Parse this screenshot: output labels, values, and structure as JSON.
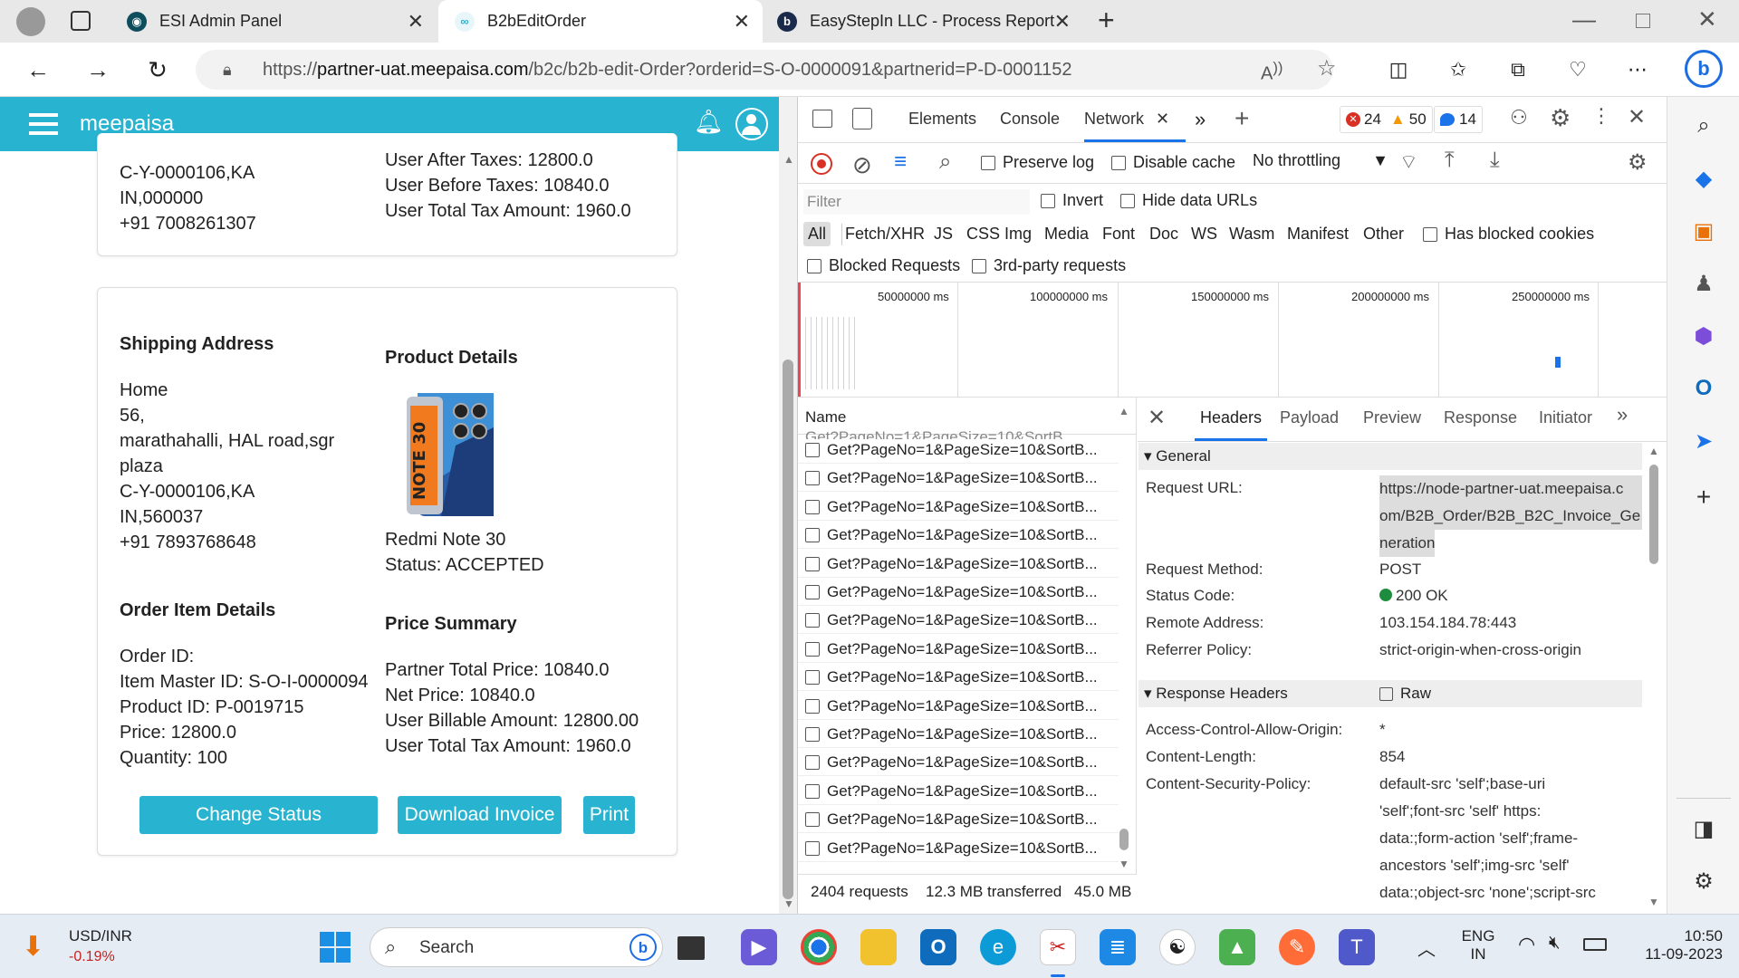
{
  "browser": {
    "tabs": [
      {
        "title": "ESI Admin Panel",
        "active": false
      },
      {
        "title": "B2bEditOrder",
        "active": true
      },
      {
        "title": "EasyStepIn LLC - Process Reportir",
        "active": false
      }
    ],
    "url_prefix": "https://",
    "url_host": "partner-uat.meepaisa.com",
    "url_path": "/b2c/b2b-edit-Order?orderid=S-O-0000091&partnerid=P-D-0001152"
  },
  "app": {
    "brand": "meepaisa",
    "top_card": {
      "left_lines": [
        "C-Y-0000106,KA",
        "IN,000000",
        "+91 7008261307"
      ],
      "right_lines": [
        "User After Taxes: 12800.0",
        "User Before Taxes: 10840.0",
        "User Total Tax Amount: 1960.0"
      ]
    },
    "shipping": {
      "heading": "Shipping Address",
      "lines": [
        "Home",
        "56,",
        "marathahalli, HAL road,sgr",
        "plaza",
        "C-Y-0000106,KA",
        "IN,560037",
        "+91 7893768648"
      ]
    },
    "product": {
      "heading": "Product Details",
      "name": "Redmi Note 30",
      "status": "Status: ACCEPTED"
    },
    "order_item": {
      "heading": "Order Item Details",
      "lines": [
        "Order ID:",
        "Item Master ID: S-O-I-0000094",
        "Product ID: P-0019715",
        "Price: 12800.0",
        "Quantity: 100"
      ]
    },
    "price_summary": {
      "heading": "Price Summary",
      "lines": [
        "Partner Total Price: 10840.0",
        "Net Price: 10840.0",
        "User Billable Amount: 12800.00",
        "User Total Tax Amount: 1960.0"
      ]
    },
    "buttons": {
      "change_status": "Change Status",
      "download_invoice": "Download Invoice",
      "print": "Print"
    }
  },
  "devtools": {
    "tabs": [
      "Elements",
      "Console",
      "Network"
    ],
    "errors": "24",
    "warnings": "50",
    "messages": "14",
    "toolbar": {
      "preserve_log": "Preserve log",
      "disable_cache": "Disable cache",
      "throttling": "No throttling"
    },
    "filter_placeholder": "Filter",
    "invert": "Invert",
    "hide_data_urls": "Hide data URLs",
    "type_filters": [
      "All",
      "Fetch/XHR",
      "JS",
      "CSS",
      "Img",
      "Media",
      "Font",
      "Doc",
      "WS",
      "Wasm",
      "Manifest",
      "Other"
    ],
    "has_blocked_cookies": "Has blocked cookies",
    "blocked_requests": "Blocked Requests",
    "third_party": "3rd-party requests",
    "timeline_ticks": [
      "50000000 ms",
      "100000000 ms",
      "150000000 ms",
      "200000000 ms",
      "250000000 ms"
    ],
    "name_header": "Name",
    "request_name": "Get?PageNo=1&PageSize=10&SortB...",
    "request_count": 15,
    "status_bar": {
      "requests": "2404 requests",
      "transferred": "12.3 MB transferred",
      "resources": "45.0 MB"
    },
    "detail_tabs": [
      "Headers",
      "Payload",
      "Preview",
      "Response",
      "Initiator"
    ],
    "general": {
      "heading": "General",
      "request_url_label": "Request URL:",
      "request_url_lines": [
        "https://node-partner-uat.meepaisa.c",
        "om/B2B_Order/B2B_B2C_Invoice_Ge",
        "neration"
      ],
      "rows": [
        {
          "k": "Request Method:",
          "v": "POST"
        },
        {
          "k": "Status Code:",
          "v": "200 OK"
        },
        {
          "k": "Remote Address:",
          "v": "103.154.184.78:443"
        },
        {
          "k": "Referrer Policy:",
          "v": "strict-origin-when-cross-origin"
        }
      ]
    },
    "response_headers": {
      "heading": "Response Headers",
      "raw": "Raw",
      "rows": [
        {
          "k": "Access-Control-Allow-Origin:",
          "v": "*"
        },
        {
          "k": "Content-Length:",
          "v": "854"
        },
        {
          "k": "Content-Security-Policy:",
          "v": "default-src 'self';base-uri"
        }
      ],
      "csp_continuation": [
        "'self';font-src 'self' https:",
        "data:;form-action 'self';frame-",
        "ancestors 'self';img-src 'self'",
        "data:;object-src 'none';script-src"
      ]
    }
  },
  "taskbar": {
    "ticker_name": "USD/INR",
    "ticker_change": "-0.19%",
    "search": "Search",
    "lang_top": "ENG",
    "lang_bottom": "IN",
    "time": "10:50",
    "date": "11-09-2023"
  }
}
